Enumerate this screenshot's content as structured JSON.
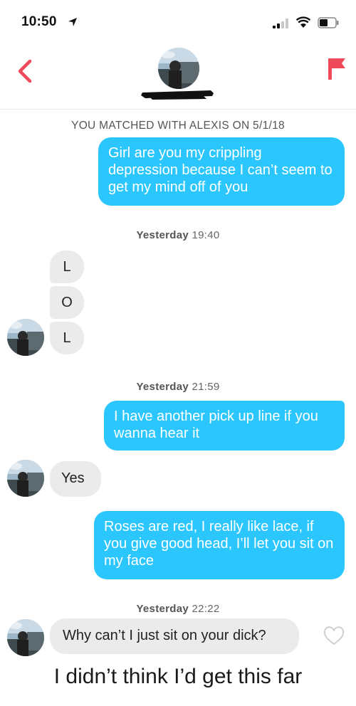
{
  "status_bar": {
    "time": "10:50"
  },
  "header": {
    "match_info": "YOU MATCHED WITH ALEXIS ON 5/1/18"
  },
  "icons": {
    "back": "back-chevron-icon",
    "report": "flag-icon",
    "like": "heart-icon",
    "location": "location-arrow-icon",
    "signal": "signal-icon",
    "wifi": "wifi-icon",
    "battery": "battery-icon"
  },
  "colors": {
    "accent_red": "#ef4a5b",
    "outgoing_bubble": "#2cc6ff",
    "incoming_bubble": "#ebebeb"
  },
  "conversation": {
    "msg1": {
      "from": "me",
      "text": "Girl are you my crippling depression because I can’t seem to get my mind off of you"
    },
    "stamp1": {
      "day": "Yesterday",
      "time": "19:40"
    },
    "letters": [
      "L",
      "O",
      "L"
    ],
    "stamp2": {
      "day": "Yesterday",
      "time": "21:59"
    },
    "msg2": {
      "from": "me",
      "text": "I have another pick up line if you wanna hear it"
    },
    "msg3": {
      "from": "them",
      "text": "Yes"
    },
    "msg4": {
      "from": "me",
      "text": "Roses are red, I really like lace, if you give good head, I’ll let you sit on my face"
    },
    "stamp3": {
      "day": "Yesterday",
      "time": "22:22"
    },
    "msg5": {
      "from": "them",
      "text": "Why can’t I just sit on your dick?"
    }
  },
  "caption": "I didn’t think I’d get this far"
}
